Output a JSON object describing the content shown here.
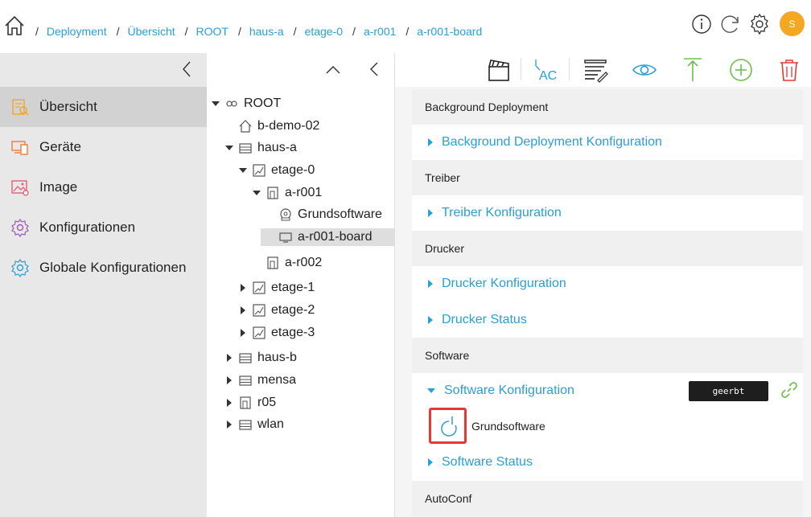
{
  "header": {
    "breadcrumbs": [
      "Deployment",
      "Übersicht",
      "ROOT",
      "haus-a",
      "etage-0",
      "a-r001",
      "a-r001-board"
    ],
    "avatar_letter": "S"
  },
  "sidebar": {
    "items": [
      {
        "label": "Übersicht",
        "icon": "overview-icon"
      },
      {
        "label": "Geräte",
        "icon": "devices-icon"
      },
      {
        "label": "Image",
        "icon": "image-icon"
      },
      {
        "label": "Konfigurationen",
        "icon": "configurations-icon"
      },
      {
        "label": "Globale Konfigurationen",
        "icon": "global-configurations-icon"
      }
    ]
  },
  "tree": {
    "nodes": [
      {
        "label": "ROOT",
        "icon": "root-icon",
        "caret": "down"
      },
      {
        "label": "b-demo-02",
        "icon": "house-icon",
        "caret": "none"
      },
      {
        "label": "haus-a",
        "icon": "building-icon",
        "caret": "down"
      },
      {
        "label": "etage-0",
        "icon": "floor-icon",
        "caret": "down"
      },
      {
        "label": "a-r001",
        "icon": "room-icon",
        "caret": "down"
      },
      {
        "label": "Grundsoftware",
        "icon": "software-disk-icon",
        "caret": "none"
      },
      {
        "label": "a-r001-board",
        "icon": "board-icon",
        "caret": "none",
        "selected": true
      },
      {
        "label": "a-r002",
        "icon": "room-icon",
        "caret": "none"
      },
      {
        "label": "etage-1",
        "icon": "floor-icon",
        "caret": "right"
      },
      {
        "label": "etage-2",
        "icon": "floor-icon",
        "caret": "right"
      },
      {
        "label": "etage-3",
        "icon": "floor-icon",
        "caret": "right"
      },
      {
        "label": "haus-b",
        "icon": "building-icon",
        "caret": "right"
      },
      {
        "label": "mensa",
        "icon": "building-icon",
        "caret": "right"
      },
      {
        "label": "r05",
        "icon": "room-icon",
        "caret": "right"
      },
      {
        "label": "wlan",
        "icon": "building-icon",
        "caret": "right"
      }
    ]
  },
  "toolbar": {
    "buttons": [
      "clapperboard-icon",
      "text-recognition-icon",
      "list-edit-icon",
      "eye-icon",
      "upload-arrow-icon",
      "add-circle-icon",
      "trash-icon"
    ]
  },
  "sections": {
    "background": {
      "title": "Background Deployment",
      "items": [
        "Background Deployment Konfiguration"
      ]
    },
    "treiber": {
      "title": "Treiber",
      "items": [
        "Treiber Konfiguration"
      ]
    },
    "drucker": {
      "title": "Drucker",
      "items": [
        "Drucker Konfiguration",
        "Drucker Status"
      ]
    },
    "software": {
      "title": "Software",
      "config_label": "Software Konfiguration",
      "inherited_badge": "geerbt",
      "software_item": "Grundsoftware",
      "status_label": "Software Status"
    },
    "autoconf": {
      "title": "AutoConf"
    }
  },
  "colors": {
    "accent": "#2a9fd6",
    "sidebar_bg": "#e8e8e8",
    "avatar": "#f5a623",
    "add_green": "#6cc04a",
    "delete_red": "#e53935",
    "highlight_border": "#e53935"
  }
}
